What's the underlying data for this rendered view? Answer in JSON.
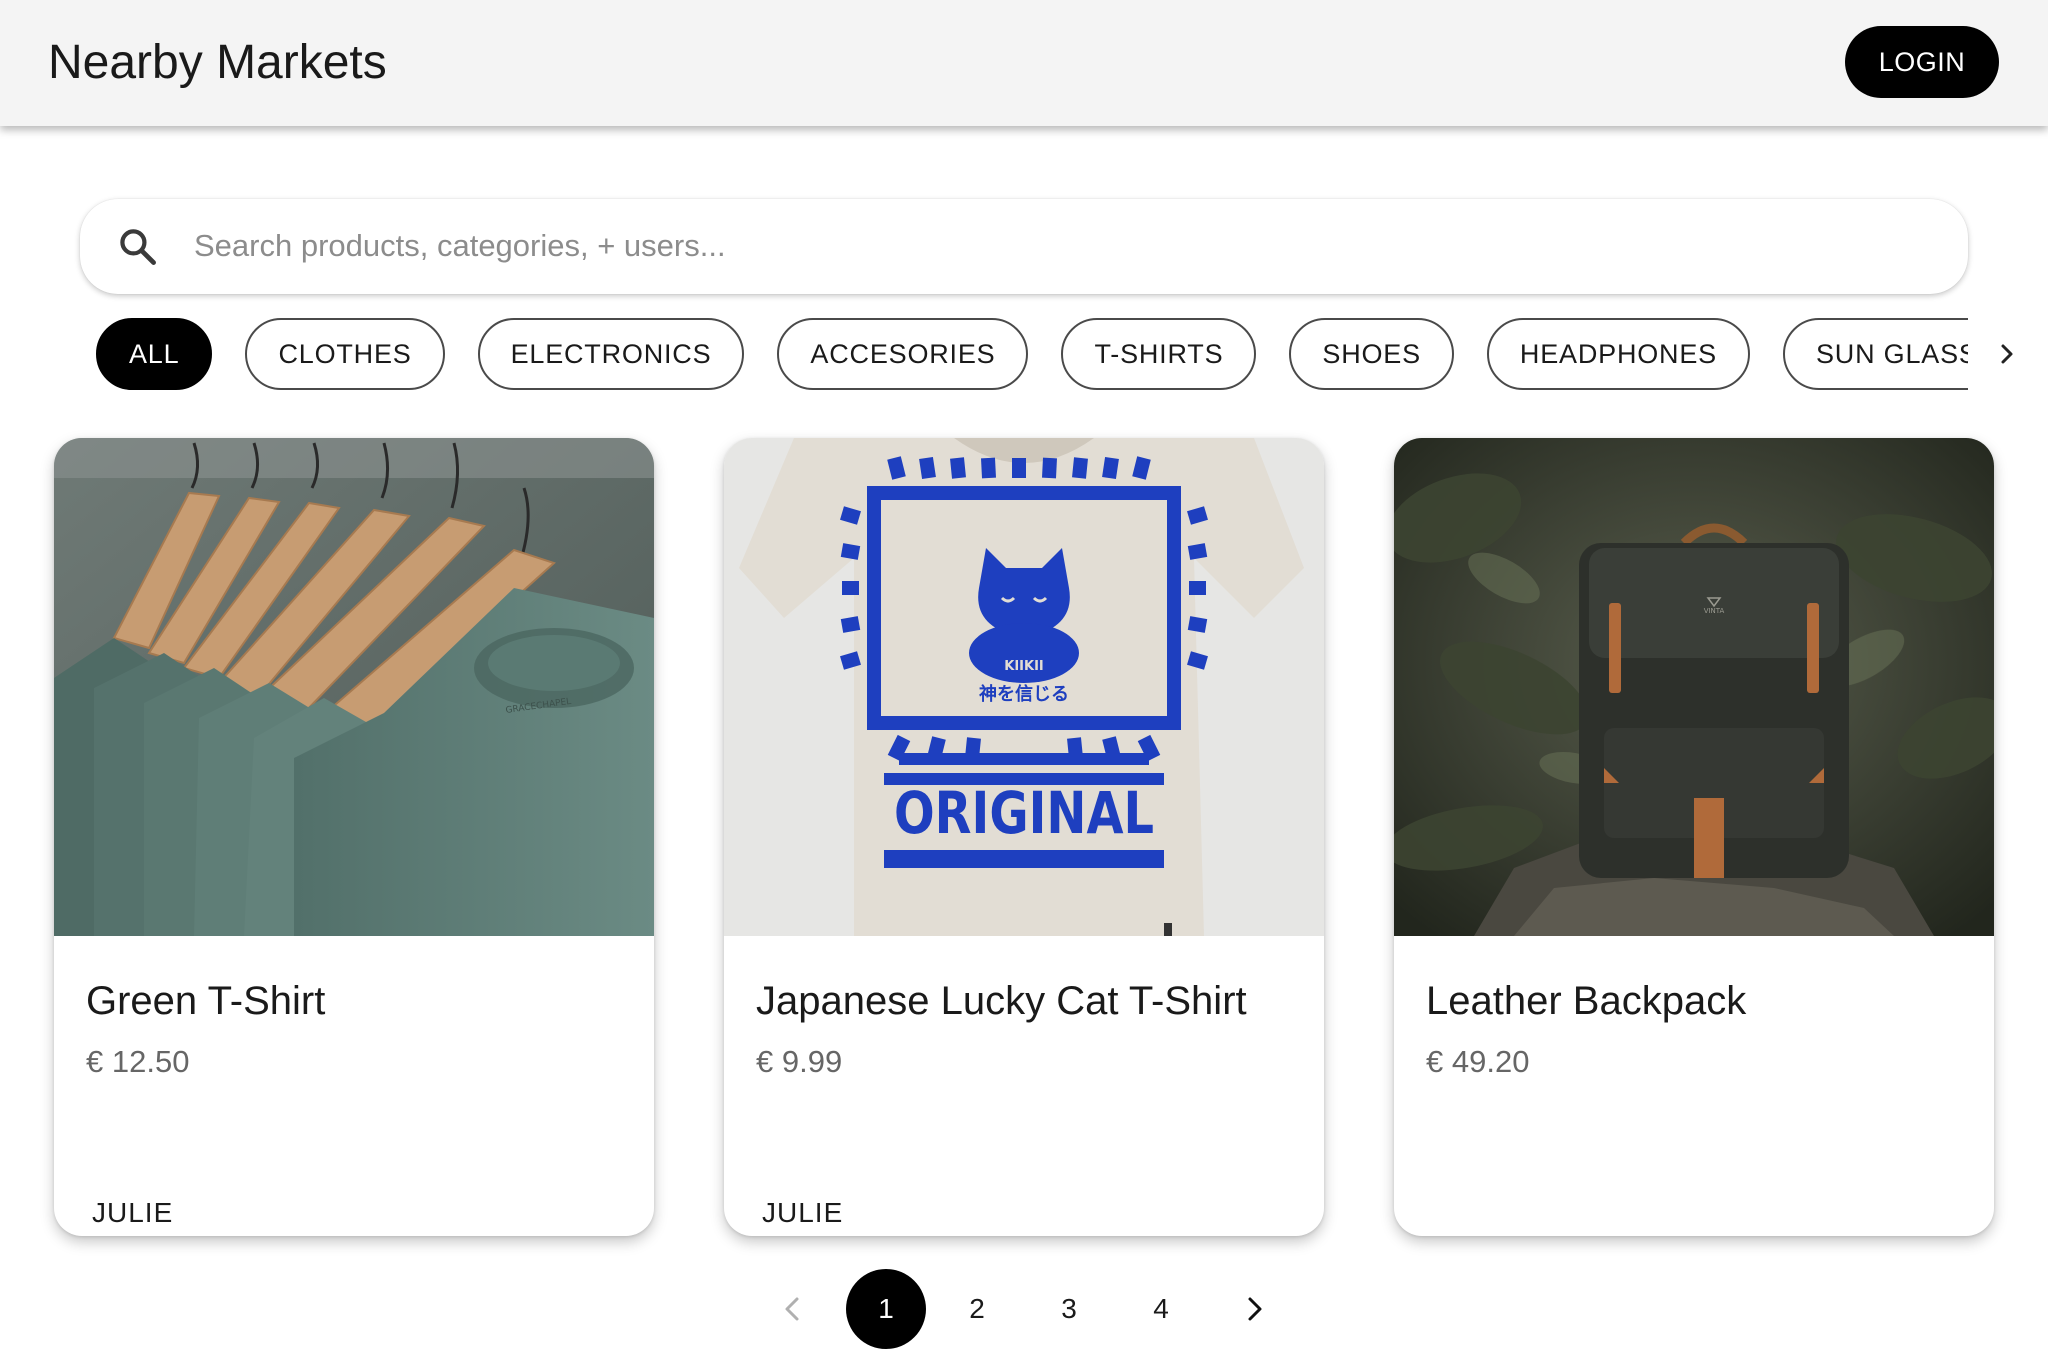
{
  "header": {
    "title": "Nearby Markets",
    "login_label": "LOGIN"
  },
  "search": {
    "placeholder": "Search products, categories, + users...",
    "value": ""
  },
  "categories": {
    "active": "ALL",
    "items": [
      "ALL",
      "CLOTHES",
      "ELECTRONICS",
      "ACCESORIES",
      "T-SHIRTS",
      "SHOES",
      "HEADPHONES",
      "SUN GLASSES"
    ]
  },
  "products": [
    {
      "title": "Green T-Shirt",
      "price": "€ 12.50",
      "seller": "JULIE",
      "image": "green-t-shirts-on-hangers"
    },
    {
      "title": "Japanese Lucky Cat T-Shirt",
      "price": "€ 9.99",
      "seller": "JULIE",
      "image": "lucky-cat-original-t-shirt",
      "print_text": {
        "brand": "KIIKII",
        "jp": "神を信じる",
        "big": "ORIGINAL"
      }
    },
    {
      "title": "Leather Backpack",
      "price": "€ 49.20",
      "seller": "",
      "image": "leather-backpack-on-rock",
      "print_text": {
        "logo": "VINTA"
      }
    }
  ],
  "pagination": {
    "pages": [
      "1",
      "2",
      "3",
      "4"
    ],
    "current": "1"
  },
  "colors": {
    "accent": "#000000",
    "header_bg": "#f4f4f4",
    "print_blue": "#1e3fbf"
  }
}
